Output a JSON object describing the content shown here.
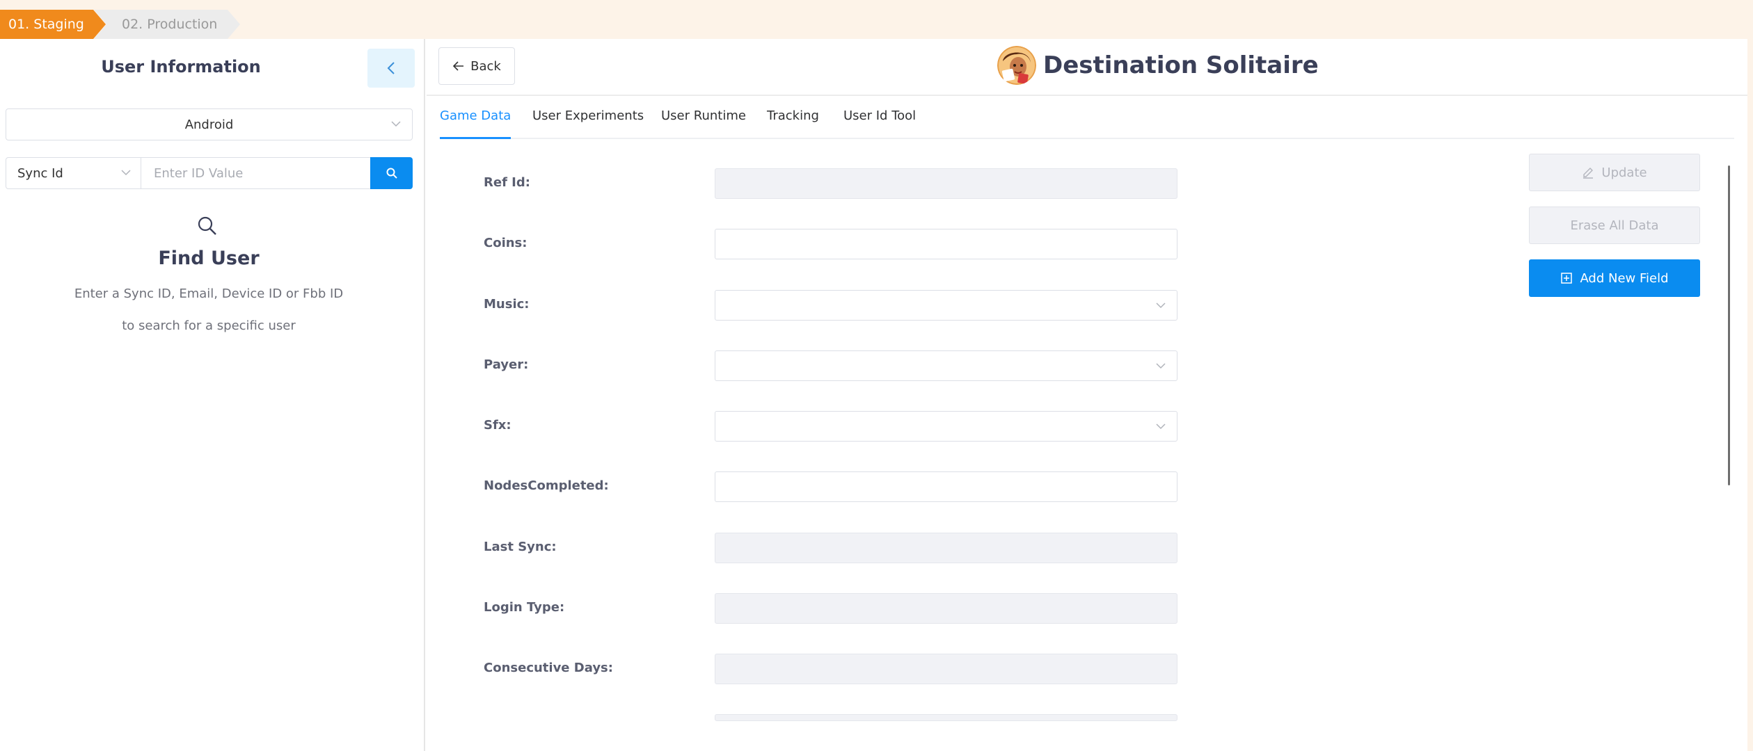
{
  "env": {
    "staging_label": "01. Staging",
    "production_label": "02. Production"
  },
  "sidebar": {
    "title": "User Information",
    "collapse_icon": "chevron-left-icon",
    "platform": "Android",
    "id_type": "Sync Id",
    "id_placeholder": "Enter ID Value",
    "find_title": "Find User",
    "find_desc_line1": "Enter a Sync ID, Email, Device ID or Fbb ID",
    "find_desc_line2": "to search for a specific user"
  },
  "header": {
    "back_label": "Back",
    "game_title": "Destination Solitaire"
  },
  "tabs": [
    {
      "label": "Game Data",
      "active": true
    },
    {
      "label": "User Experiments",
      "active": false
    },
    {
      "label": "User Runtime",
      "active": false
    },
    {
      "label": "Tracking",
      "active": false
    },
    {
      "label": "User Id Tool",
      "active": false
    }
  ],
  "form": {
    "fields": [
      {
        "label": "Ref Id",
        "type": "text",
        "disabled": true,
        "value": ""
      },
      {
        "label": "Coins",
        "type": "text",
        "disabled": false,
        "value": ""
      },
      {
        "label": "Music",
        "type": "select",
        "disabled": false,
        "value": ""
      },
      {
        "label": "Payer",
        "type": "select",
        "disabled": false,
        "value": ""
      },
      {
        "label": "Sfx",
        "type": "select",
        "disabled": false,
        "value": ""
      },
      {
        "label": "NodesCompleted",
        "type": "text",
        "disabled": false,
        "value": ""
      },
      {
        "label": "Last Sync",
        "type": "text",
        "disabled": true,
        "value": ""
      },
      {
        "label": "Login Type",
        "type": "text",
        "disabled": true,
        "value": ""
      },
      {
        "label": "Consecutive Days",
        "type": "text",
        "disabled": true,
        "value": ""
      }
    ]
  },
  "actions": {
    "update_label": "Update",
    "erase_label": "Erase All Data",
    "add_label": "Add New Field"
  },
  "colors": {
    "accent": "#0a8cf0",
    "staging": "#f08a1c",
    "tab_active": "#1890ff"
  }
}
